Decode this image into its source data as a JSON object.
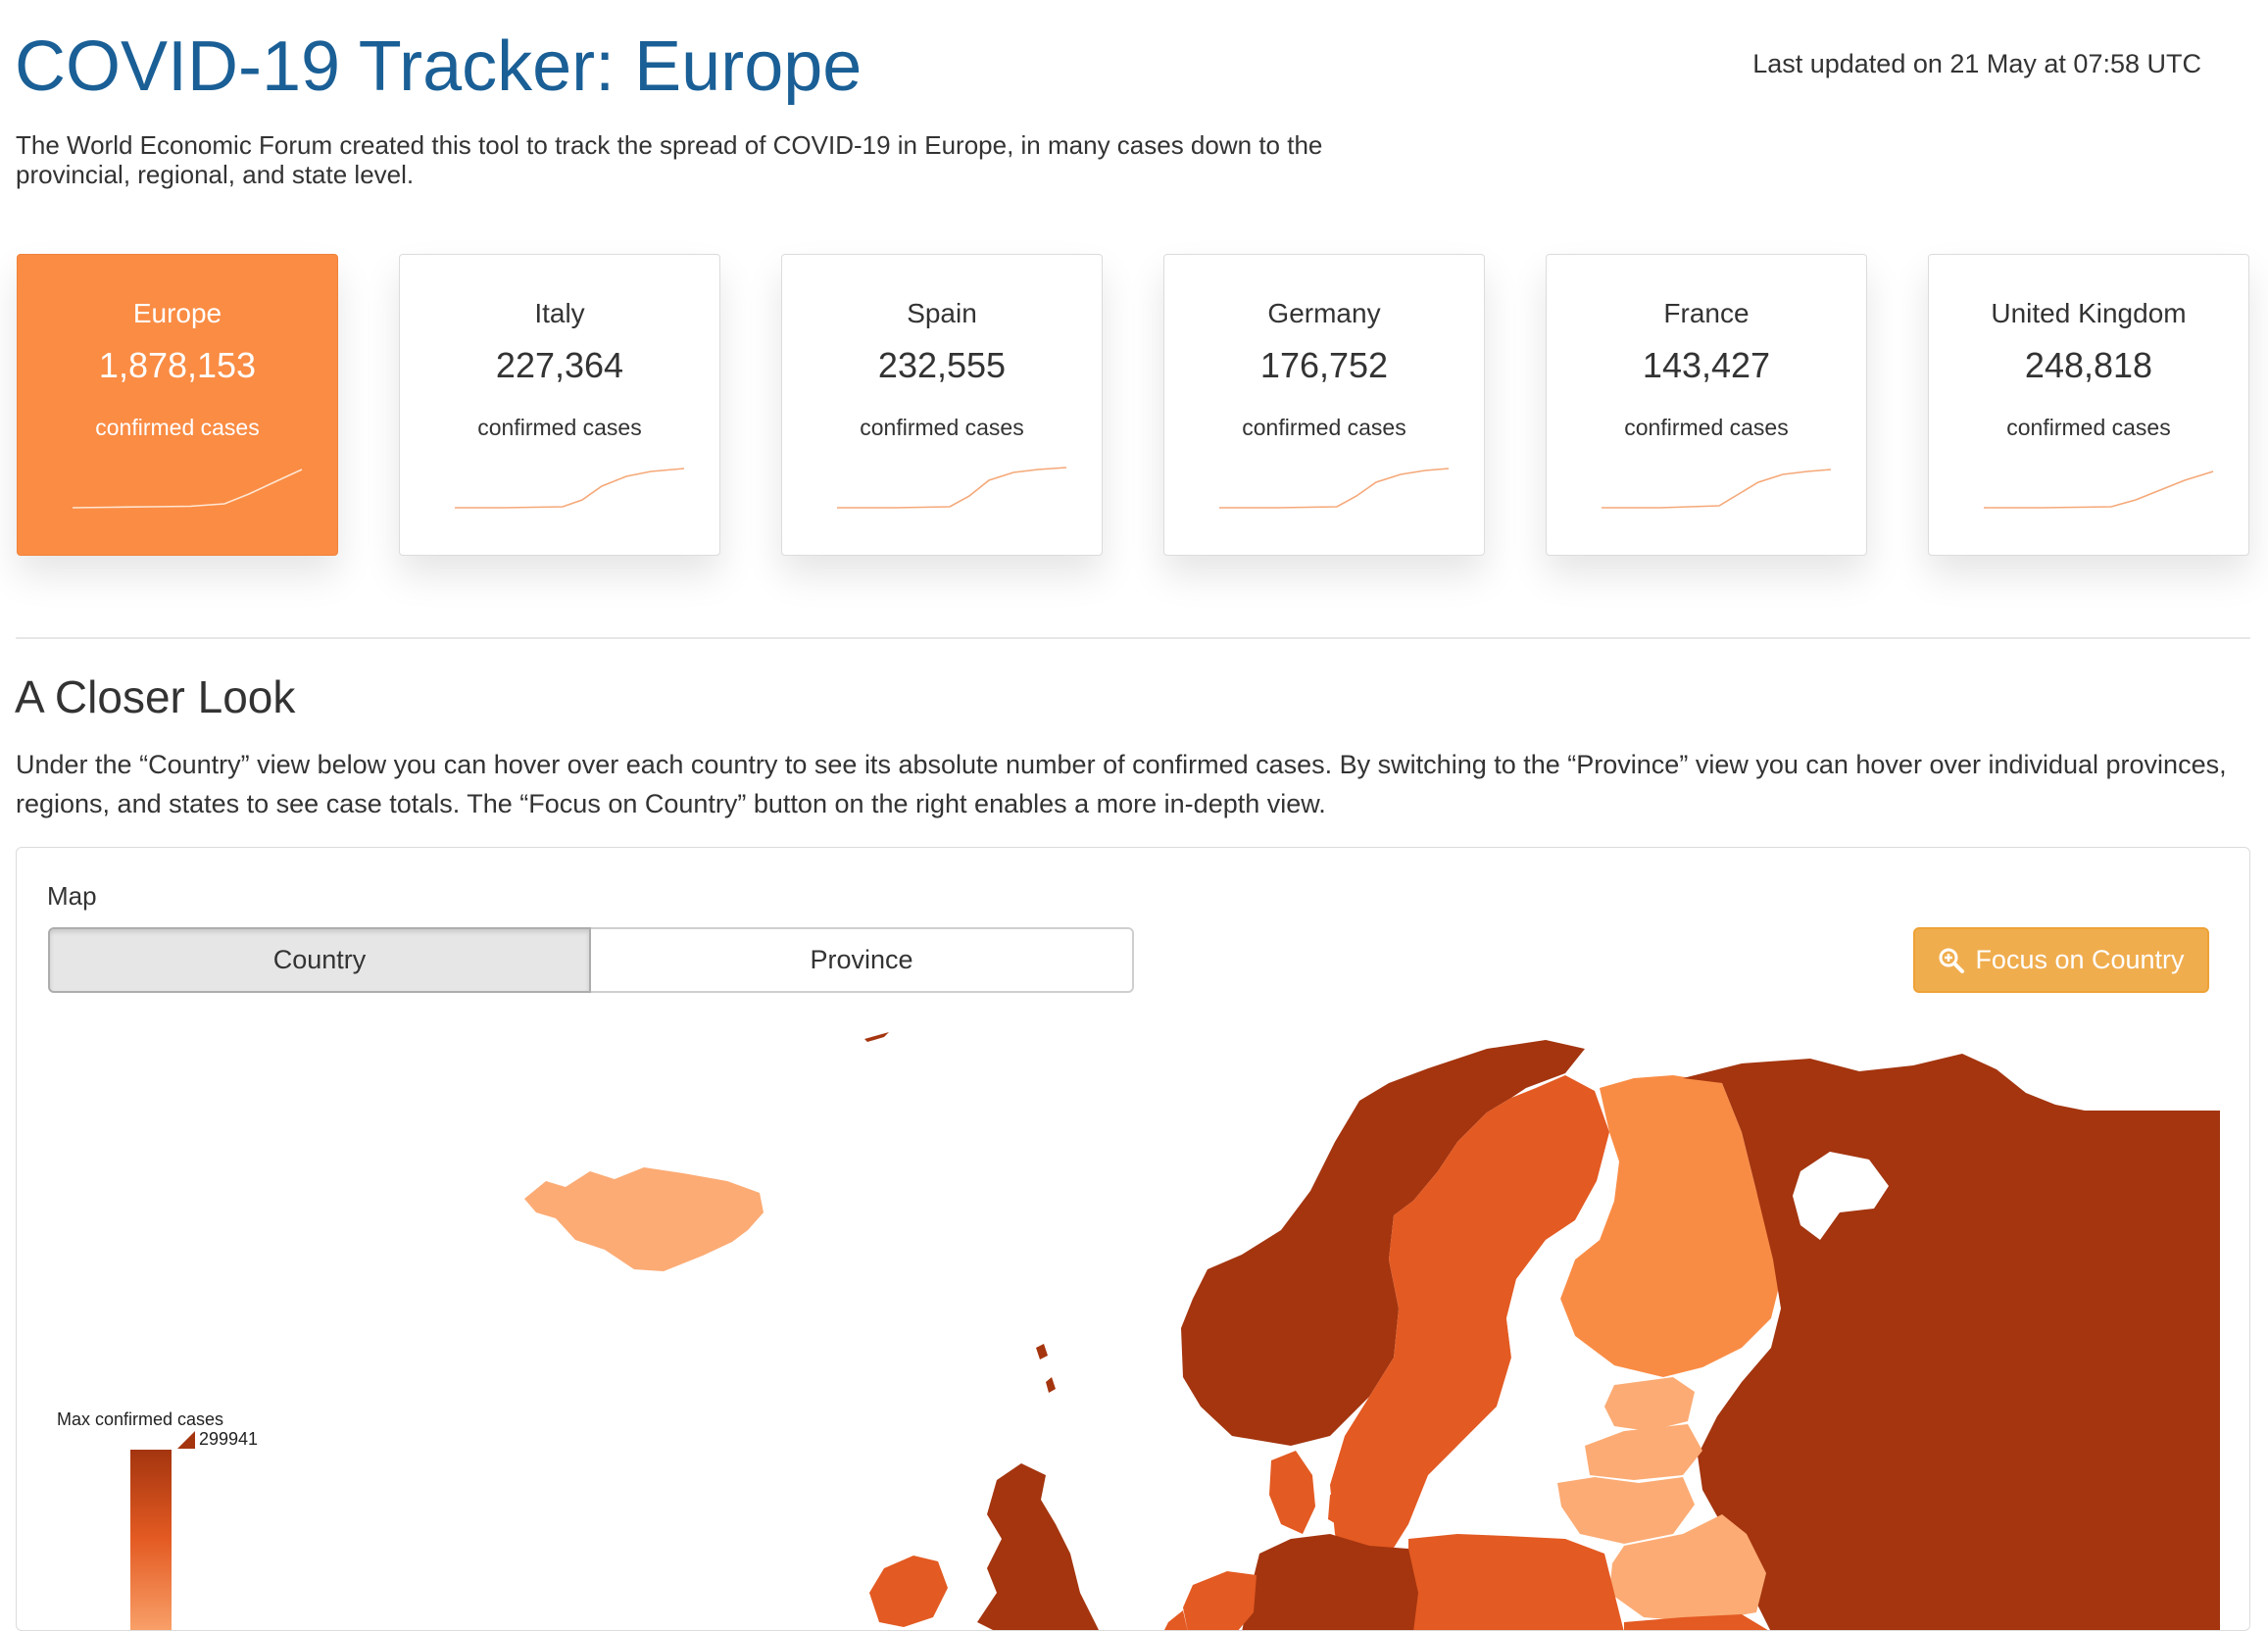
{
  "header": {
    "title": "COVID-19 Tracker: Europe",
    "last_updated": "Last updated on 21 May at 07:58 UTC",
    "intro": "The World Economic Forum created this tool to track the spread of COVID-19 in Europe, in many cases down to the provincial, regional, and state level."
  },
  "cards": [
    {
      "name": "Europe",
      "value": "1,878,153",
      "unit": "confirmed cases",
      "active": true
    },
    {
      "name": "Italy",
      "value": "227,364",
      "unit": "confirmed cases",
      "active": false
    },
    {
      "name": "Spain",
      "value": "232,555",
      "unit": "confirmed cases",
      "active": false
    },
    {
      "name": "Germany",
      "value": "176,752",
      "unit": "confirmed cases",
      "active": false
    },
    {
      "name": "France",
      "value": "143,427",
      "unit": "confirmed cases",
      "active": false
    },
    {
      "name": "United Kingdom",
      "value": "248,818",
      "unit": "confirmed cases",
      "active": false
    }
  ],
  "closer_look": {
    "title": "A Closer Look",
    "text": "Under the “Country” view below you can hover over each country to see its absolute number of confirmed cases. By switching to the “Province” view you can hover over individual provinces, regions, and states to see case totals. The “Focus on Country” button on the right enables a more in-depth view."
  },
  "map": {
    "label": "Map",
    "toggle": {
      "country_label": "Country",
      "province_label": "Province",
      "selected": "Country"
    },
    "focus_button_label": "Focus on Country",
    "focus_icon": "zoom-in-icon",
    "legend": {
      "title": "Max confirmed cases",
      "max_value": "299941"
    },
    "colors": {
      "high": "#a4350f",
      "mid_high": "#e35a22",
      "mid": "#f98c45",
      "low": "#fcab74",
      "accent_card": "#fa8c44",
      "focus_button": "#f0ad4e"
    }
  }
}
